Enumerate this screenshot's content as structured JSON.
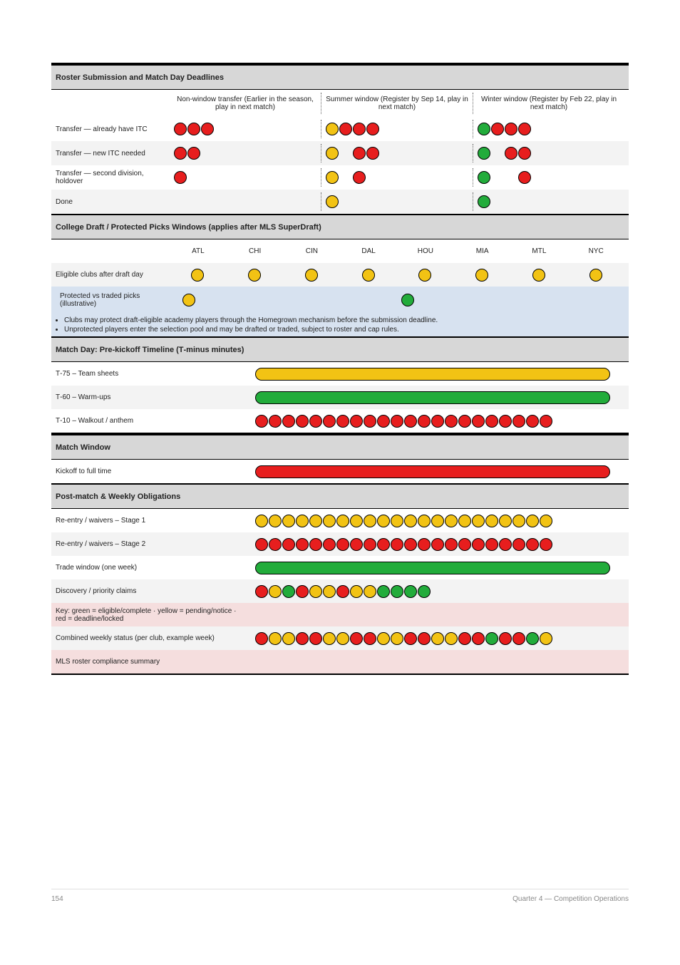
{
  "section1": {
    "title": "Roster Submission and Match Day Deadlines"
  },
  "triHeader": [
    "Non‑window transfer (Earlier in the season, play in next match)",
    "Summer window (Register by Sep 14, play in next match)",
    "Winter window (Register by Feb 22, play in next match)"
  ],
  "rows_top": [
    {
      "label": "Transfer — already have ITC",
      "cols": [
        [
          "r",
          "r",
          "r"
        ],
        [
          "y",
          "r",
          "r",
          "r"
        ],
        [
          "g",
          "r",
          "r",
          "r"
        ]
      ]
    },
    {
      "label": "Transfer — new ITC needed",
      "cols": [
        [
          "r",
          "r"
        ],
        [
          "y",
          "",
          "r",
          "r"
        ],
        [
          "g",
          "",
          "r",
          "r"
        ]
      ]
    },
    {
      "label": "Transfer — second division, holdover",
      "cols": [
        [
          "r"
        ],
        [
          "y",
          "",
          "r"
        ],
        [
          "g",
          "",
          "",
          "r"
        ]
      ]
    },
    {
      "label": "Done",
      "cols": [
        [],
        [
          "y"
        ],
        [
          "g"
        ]
      ]
    }
  ],
  "section2": {
    "title": "College Draft / Protected Picks Windows (applies after MLS SuperDraft)"
  },
  "row_clubs": {
    "label": "Eligible clubs after draft day",
    "clubs": [
      "ATL",
      "CHI",
      "CIN",
      "DAL",
      "HOU",
      "MIA",
      "MTL",
      "NYC"
    ],
    "dots": [
      "y",
      "y",
      "y",
      "y",
      "y",
      "y",
      "y",
      "y"
    ]
  },
  "row_keep": {
    "label": "Protected vs traded picks (illustrative)",
    "left": "y",
    "right": "g"
  },
  "bullets": [
    "Clubs may protect draft‑eligible academy players through the Homegrown mechanism before the submission deadline.",
    "Unprotected players enter the selection pool and may be drafted or traded, subject to roster and cap rules."
  ],
  "section3": {
    "title": "Match Day: Pre‑kickoff Timeline (T‑minus minutes)"
  },
  "rows_match": [
    {
      "label": "T‑75 – Team sheets",
      "pill": "y",
      "len": 498
    },
    {
      "label": "T‑60 – Warm‑ups",
      "pill": "g",
      "len": 498
    },
    {
      "label": "T‑10 – Walkout / anthem",
      "dots": 22,
      "color": "r"
    }
  ],
  "section4": {
    "title": "Match Window"
  },
  "rows_window": [
    {
      "label": "Kickoff to full time",
      "pill": "r",
      "len": 498
    }
  ],
  "section5": {
    "title": "Post‑match & Weekly Obligations"
  },
  "rows_post": [
    {
      "label": "Re‑entry / waivers – Stage 1",
      "dots": 22,
      "color": "y"
    },
    {
      "label": "Re‑entry / waivers – Stage 2",
      "dots": 22,
      "color": "r"
    },
    {
      "label": "Trade window (one week)",
      "pill": "g",
      "len": 498
    },
    {
      "label": "Discovery / priority claims",
      "special": "mixed13"
    },
    {
      "label": "Key: green = eligible/complete · yellow = pending/notice · red = deadline/locked",
      "empty": true,
      "pink": true
    },
    {
      "label": "Combined weekly status (per club, example week)",
      "special": "mixed22"
    },
    {
      "label": "MLS roster compliance summary",
      "empty": true,
      "pink": true
    }
  ],
  "mixed13": [
    "r",
    "y",
    "g",
    "r",
    "y",
    "y",
    "r",
    "y",
    "y",
    "g",
    "g",
    "g",
    "g"
  ],
  "mixed22": [
    "r",
    "y",
    "y",
    "r",
    "r",
    "y",
    "y",
    "r",
    "r",
    "y",
    "y",
    "r",
    "r",
    "y",
    "y",
    "r",
    "r",
    "g",
    "r",
    "r",
    "g",
    "y"
  ],
  "footer": {
    "page": "154",
    "right": "Quarter 4 — Competition Operations"
  }
}
